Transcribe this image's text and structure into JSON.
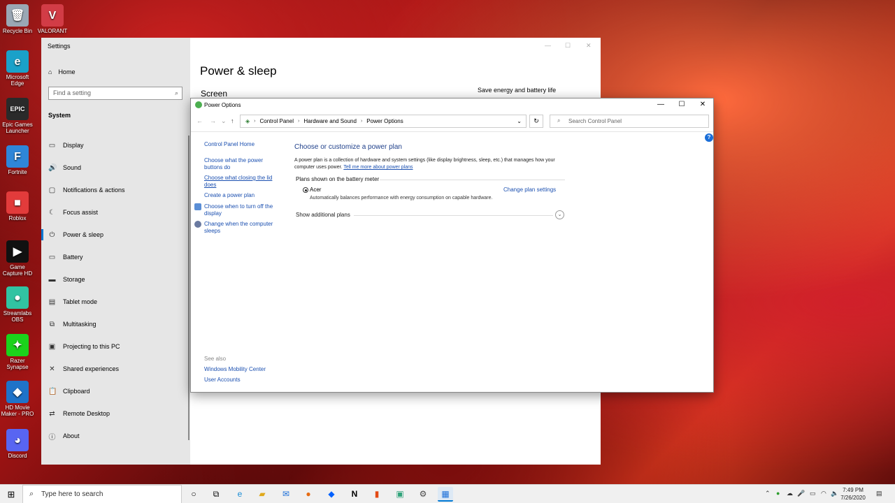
{
  "desktop": {
    "icons": [
      {
        "label": "Recycle Bin",
        "glyph": "🗑",
        "color": "#9aa7b4"
      },
      {
        "label": "VALORANT",
        "glyph": "V",
        "color": "#d23c46"
      },
      {
        "label": "Microsoft Edge",
        "glyph": "e",
        "color": "#1aa1c9"
      },
      {
        "label": "Epic Games Launcher",
        "glyph": "EPIC",
        "color": "#2a2a2a"
      },
      {
        "label": "Fortnite",
        "glyph": "F",
        "color": "#2f86d8"
      },
      {
        "label": "Roblox",
        "glyph": "■",
        "color": "#e23b3b"
      },
      {
        "label": "Game Capture HD",
        "glyph": "▶",
        "color": "#111"
      },
      {
        "label": "Streamlabs OBS",
        "glyph": "●",
        "color": "#31c3a2"
      },
      {
        "label": "Razer Synapse",
        "glyph": "✦",
        "color": "#1bd31b"
      },
      {
        "label": "HD Movie Maker - PRO",
        "glyph": "◆",
        "color": "#1f73c9"
      },
      {
        "label": "Discord",
        "glyph": "◕",
        "color": "#5865f2"
      }
    ]
  },
  "settings": {
    "title": "Settings",
    "home": "Home",
    "search_placeholder": "Find a setting",
    "section": "System",
    "nav": [
      {
        "label": "Display",
        "icon": "▭"
      },
      {
        "label": "Sound",
        "icon": "🔊"
      },
      {
        "label": "Notifications & actions",
        "icon": "▢"
      },
      {
        "label": "Focus assist",
        "icon": "☾"
      },
      {
        "label": "Power & sleep",
        "icon": "⏻"
      },
      {
        "label": "Battery",
        "icon": "▭"
      },
      {
        "label": "Storage",
        "icon": "▬"
      },
      {
        "label": "Tablet mode",
        "icon": "▤"
      },
      {
        "label": "Multitasking",
        "icon": "⧉"
      },
      {
        "label": "Projecting to this PC",
        "icon": "▣"
      },
      {
        "label": "Shared experiences",
        "icon": "✕"
      },
      {
        "label": "Clipboard",
        "icon": "📋"
      },
      {
        "label": "Remote Desktop",
        "icon": "⇄"
      },
      {
        "label": "About",
        "icon": "ⓘ"
      }
    ],
    "active_index": 4,
    "page_title": "Power & sleep",
    "page_sub": "Screen",
    "aside": "Save energy and battery life"
  },
  "power": {
    "title": "Power Options",
    "breadcrumb": [
      "Control Panel",
      "Hardware and Sound",
      "Power Options"
    ],
    "search_placeholder": "Search Control Panel",
    "left": {
      "home": "Control Panel Home",
      "links": [
        "Choose what the power buttons do",
        "Choose what closing the lid does",
        "Create a power plan",
        "Choose when to turn off the display",
        "Change when the computer sleeps"
      ],
      "see_also": "See also",
      "see_also_links": [
        "Windows Mobility Center",
        "User Accounts"
      ]
    },
    "main": {
      "heading": "Choose or customize a power plan",
      "desc": "A power plan is a collection of hardware and system settings (like display brightness, sleep, etc.) that manages how your computer uses power.",
      "desc_link": "Tell me more about power plans",
      "section": "Plans shown on the battery meter",
      "plan_name": "Acer",
      "plan_change": "Change plan settings",
      "plan_desc": "Automatically balances performance with energy consumption on capable hardware.",
      "more_plans": "Show additional plans"
    }
  },
  "taskbar": {
    "search_placeholder": "Type here to search",
    "time": "7:49 PM",
    "date": "7/26/2020"
  }
}
